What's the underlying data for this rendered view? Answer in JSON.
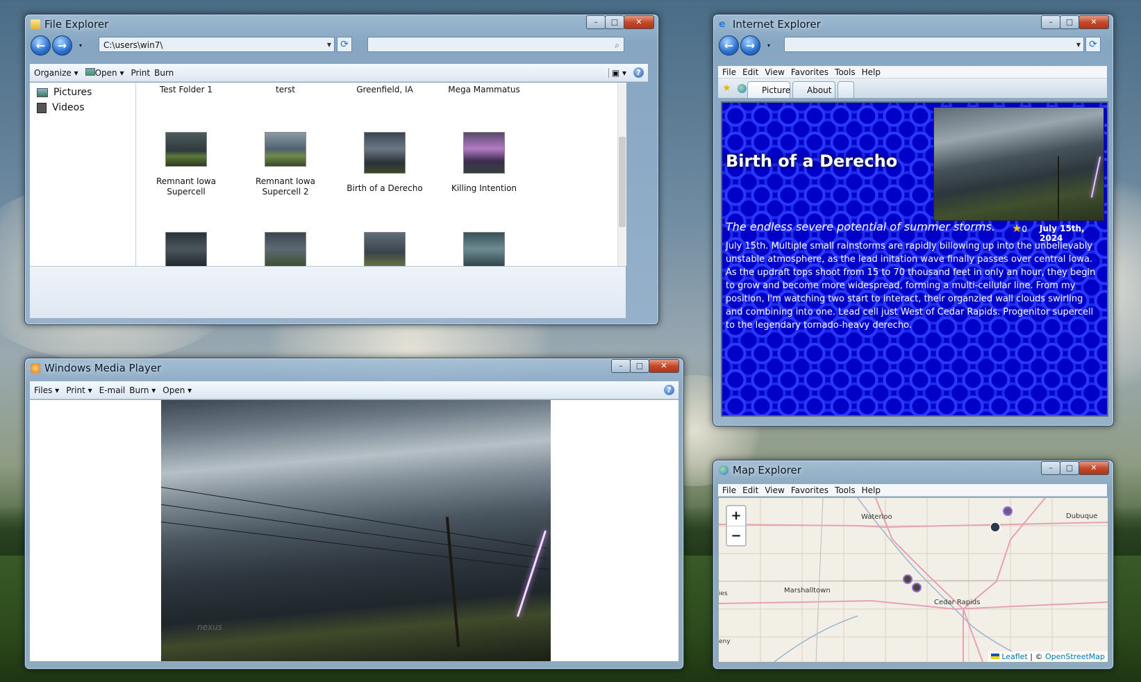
{
  "file_explorer": {
    "title": "File Explorer",
    "address": "C:\\users\\win7\\",
    "search_placeholder": "",
    "toolbar": {
      "organize": "Organize",
      "open": "Open",
      "print": "Print",
      "burn": "Burn"
    },
    "sidebar": [
      {
        "label": "Pictures"
      },
      {
        "label": "Videos"
      }
    ],
    "folders": [
      "Test Folder 1",
      "terst",
      "Greenfield, IA",
      "Mega Mammatus"
    ],
    "images": [
      {
        "label": "Remnant Iowa Supercell"
      },
      {
        "label": "Remnant Iowa Supercell 2"
      },
      {
        "label": "Birth of a Derecho"
      },
      {
        "label": "Killing Intention"
      }
    ]
  },
  "internet_explorer": {
    "title": "Internet Explorer",
    "address": "",
    "menu": [
      "File",
      "Edit",
      "View",
      "Favorites",
      "Tools",
      "Help"
    ],
    "tabs": [
      "Picture",
      "About"
    ],
    "page": {
      "heading": "Birth of a Derecho",
      "subtitle": "The endless severe potential of summer storms.",
      "rating": "0",
      "date": "July 15th, 2024",
      "body": "July 15th. Multiple small rainstorms are rapidly billowing up into the unbelievably unstable atmosphere, as the lead initation wave finally passes over central Iowa. As the updraft tops shoot from 15 to 70 thousand feet in only an hour, they begin to grow and become more widespread, forming a multi-cellular line. From my position, I'm watching two start to interact, their organzied wall clouds swirling and combining into one. Lead cell just West of Cedar Rapids. Progenitor supercell to the legendary tornado-heavy derecho."
    }
  },
  "media_player": {
    "title": "Windows Media Player",
    "toolbar": {
      "files": "Files",
      "print": "Print",
      "email": "E-mail",
      "burn": "Burn",
      "open": "Open"
    },
    "watermark": "nexus"
  },
  "map_explorer": {
    "title": "Map Explorer",
    "menu": [
      "File",
      "Edit",
      "View",
      "Favorites",
      "Tools",
      "Help"
    ],
    "zoom_in": "+",
    "zoom_out": "−",
    "places": [
      "Waterloo",
      "Dubuque",
      "Marshalltown",
      "Cedar Rapids",
      "ies",
      "eny"
    ],
    "attribution": {
      "leaflet": "Leaflet",
      "separator": "| ©",
      "osm": "OpenStreetMap"
    }
  },
  "icons": {
    "back": "←",
    "forward": "→",
    "refresh": "⟳",
    "search": "⌕",
    "minimize": "–",
    "maximize": "□",
    "close": "✕",
    "help": "?",
    "star": "★"
  }
}
